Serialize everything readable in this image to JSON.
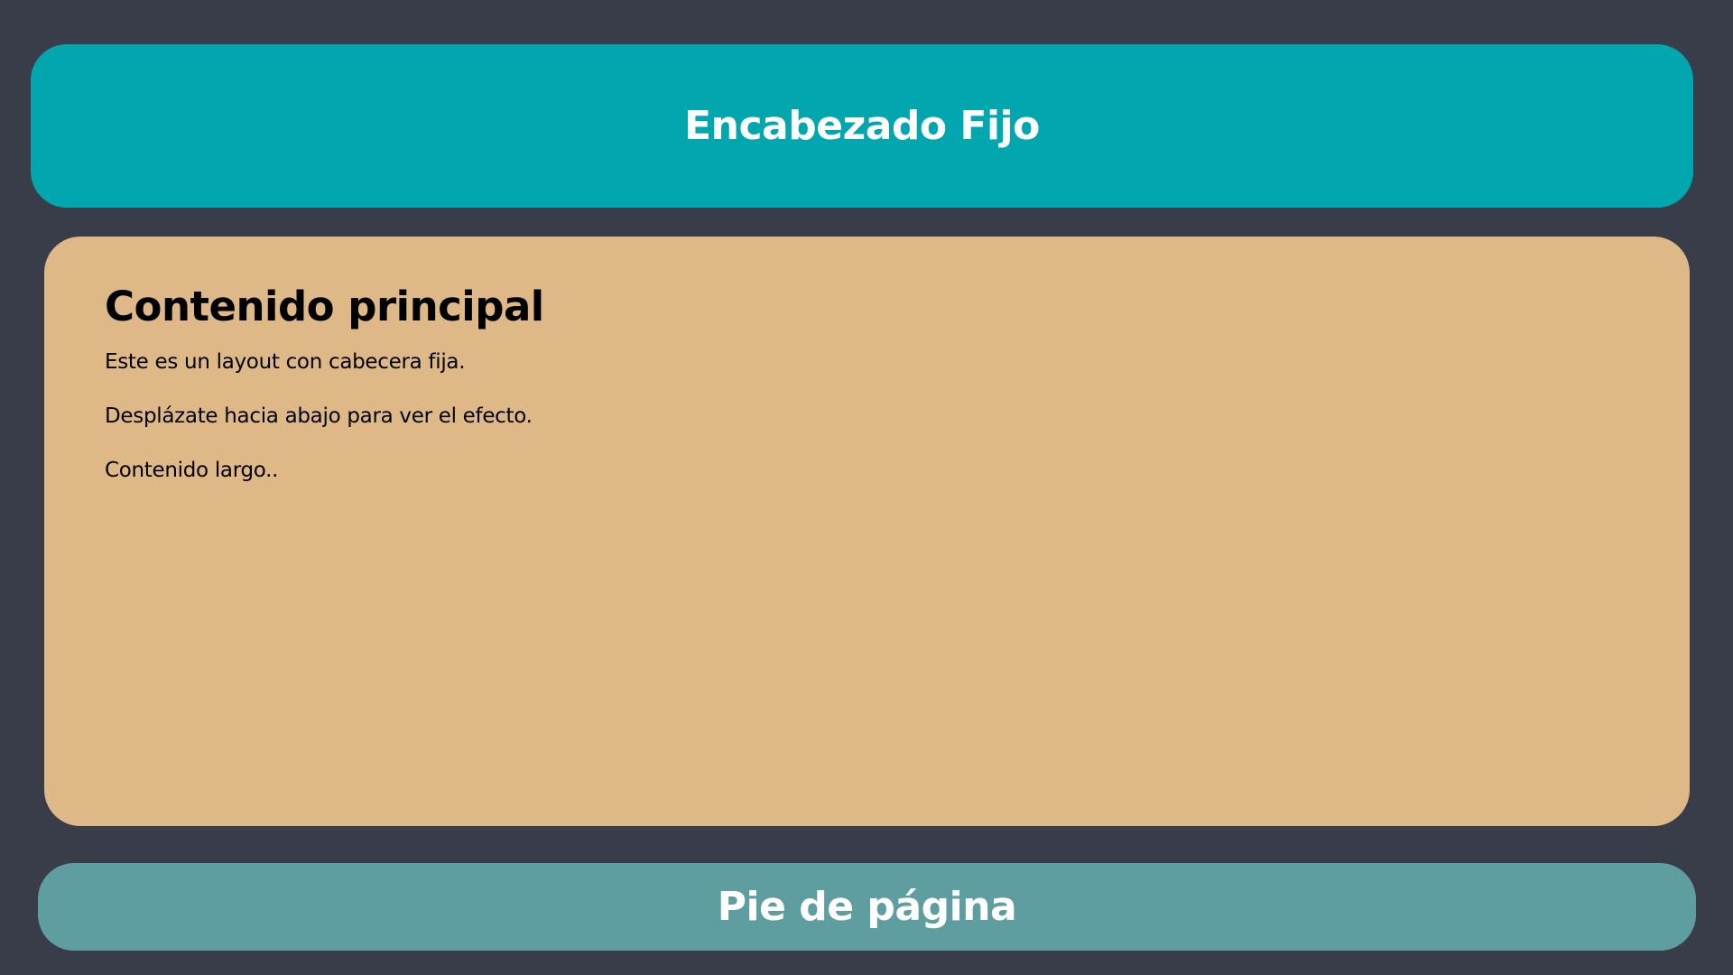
{
  "header": {
    "title": "Encabezado Fijo"
  },
  "main": {
    "heading": "Contenido principal",
    "paragraphs": [
      "Este es un layout con cabecera fija.",
      "Desplázate hacia abajo para ver el efecto.",
      "Contenido largo.."
    ]
  },
  "footer": {
    "text": "Pie de página"
  },
  "colors": {
    "background": "#393d49",
    "header": "#01a6ae",
    "main": "#deb887",
    "footer": "#5f9ea0"
  }
}
